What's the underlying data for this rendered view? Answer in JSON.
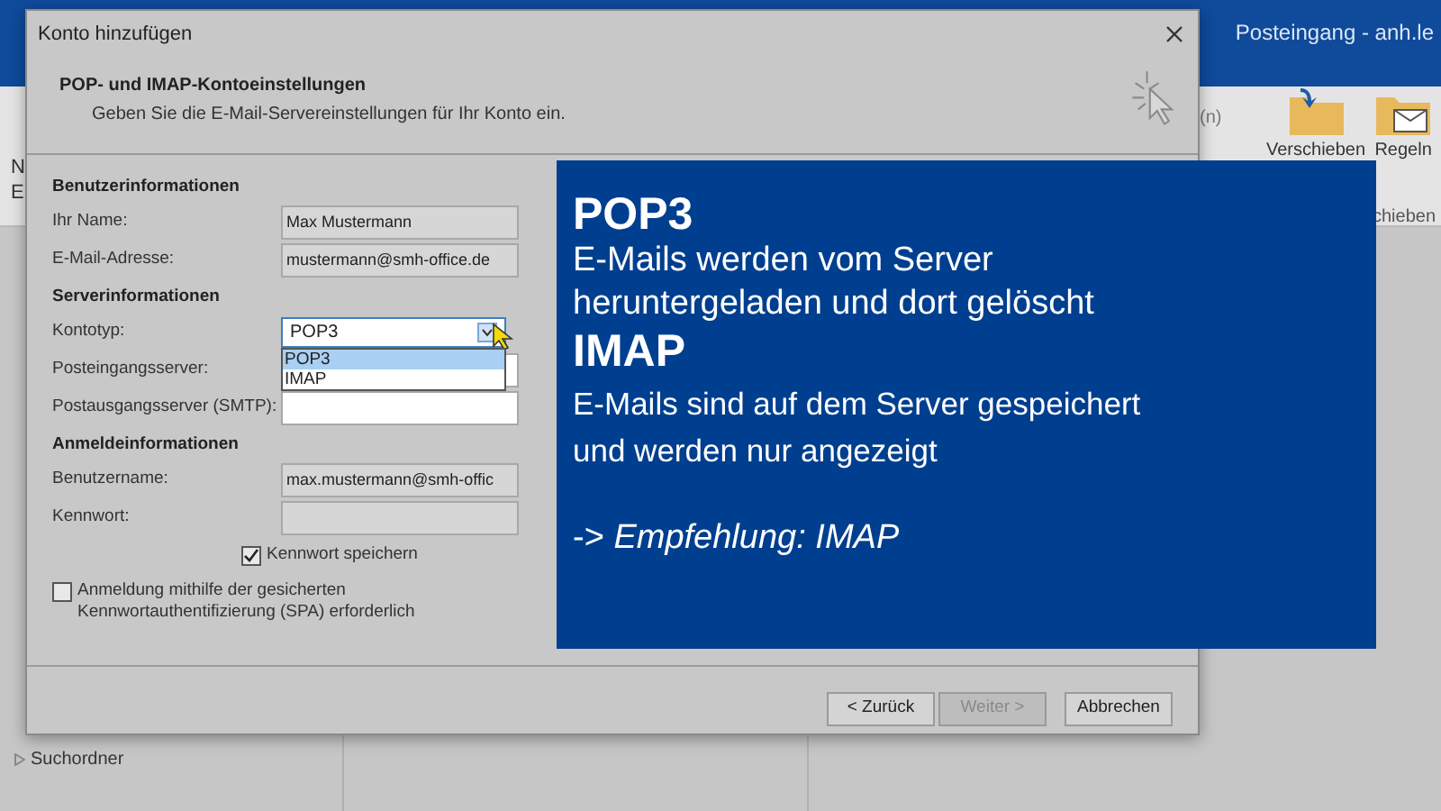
{
  "background_app": {
    "title": "Posteingang - anh.le",
    "ribbon": {
      "left_fragments": [
        "N",
        "E"
      ],
      "fragment": "(n)",
      "buttons": [
        {
          "label": "Verschieben",
          "kind": "move"
        },
        {
          "label": "Regeln",
          "kind": "rules"
        }
      ],
      "group_label": "chieben"
    },
    "folders": [
      {
        "label": "Suchordner",
        "expanded": false
      }
    ]
  },
  "dialog": {
    "title": "Konto hinzufügen",
    "heading": "POP- und IMAP-Kontoeinstellungen",
    "subheading": "Geben Sie die E-Mail-Servereinstellungen für Ihr Konto ein.",
    "rows": [
      {
        "kind": "heading",
        "label": "Benutzerinformationen"
      },
      {
        "kind": "field",
        "label": "Ihr Name:",
        "value": "Max Mustermann"
      },
      {
        "kind": "field",
        "label": "E-Mail-Adresse:",
        "value": "mustermann@smh-office.de"
      },
      {
        "kind": "heading",
        "label": "Serverinformationen"
      },
      {
        "kind": "combo",
        "label": "Kontotyp:",
        "value": "POP3",
        "expanded": true,
        "options": [
          {
            "label": "POP3",
            "selected": true
          },
          {
            "label": "IMAP",
            "selected": false
          }
        ]
      },
      {
        "kind": "field",
        "label": "Posteingangsserver:"
      },
      {
        "kind": "field",
        "label": "Postausgangsserver (SMTP):",
        "value": ""
      },
      {
        "kind": "heading",
        "label": "Anmeldeinformationen"
      },
      {
        "kind": "field",
        "label": "Benutzername:",
        "value": "max.mustermann@smh-offic"
      },
      {
        "kind": "field",
        "label": "Kennwort:",
        "value": ""
      },
      {
        "kind": "checkbox",
        "label": "Kennwort speichern",
        "checked": true
      },
      {
        "kind": "checkbox_wide",
        "label": "Anmeldung mithilfe der gesicherten\nKennwortauthentifizierung (SPA) erforderlich",
        "checked": false
      }
    ],
    "buttons": [
      {
        "label": "< Zurück",
        "disabled": false
      },
      {
        "label": "Weiter >",
        "disabled": true
      },
      {
        "label": "Abbrechen",
        "disabled": false
      }
    ]
  },
  "overlay": {
    "blocks": [
      {
        "kind": "heading",
        "text": "POP3"
      },
      {
        "kind": "text",
        "lines": [
          "E-Mails werden vom Server",
          "heruntergeladen und dort gelöscht"
        ]
      },
      {
        "kind": "heading",
        "text": "IMAP"
      },
      {
        "kind": "small",
        "lines": [
          "E-Mails sind auf dem Server gespeichert",
          "und werden nur angezeigt"
        ]
      },
      {
        "kind": "note",
        "text": "-> *Empfehlung: IMAP*"
      }
    ]
  }
}
